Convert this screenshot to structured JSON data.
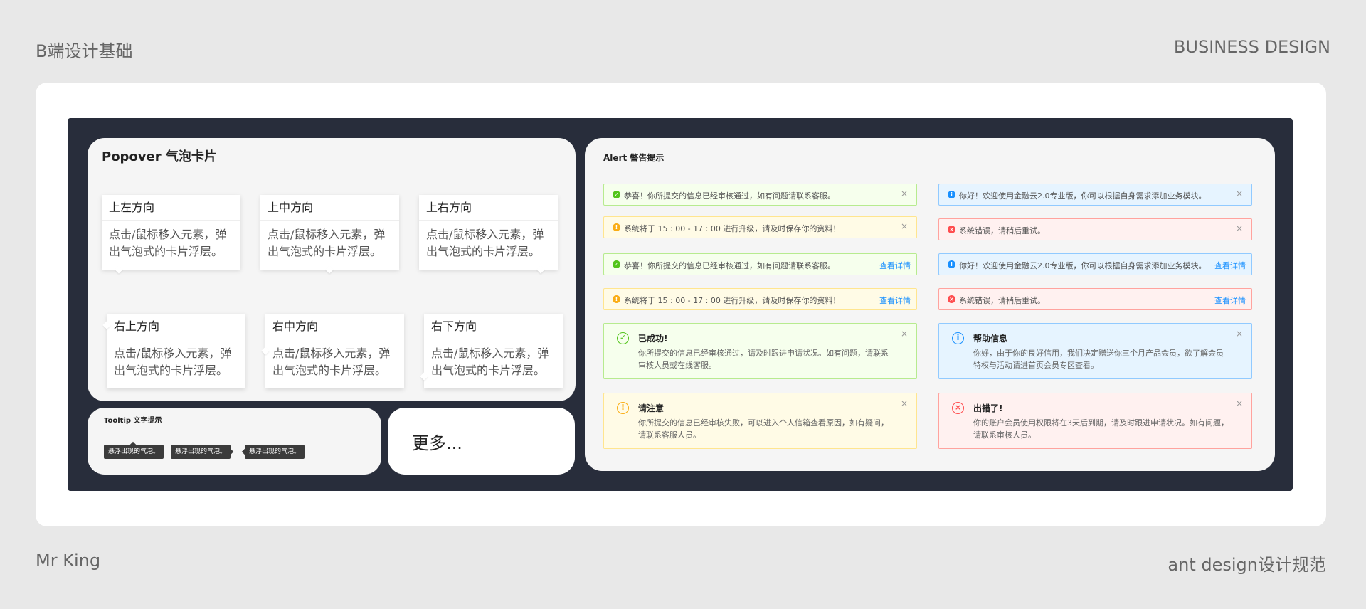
{
  "header": {
    "left": "B端设计基础",
    "right": "BUSINESS DESIGN"
  },
  "footer": {
    "left": "Mr King",
    "right": "ant design设计规范"
  },
  "popover": {
    "title": "Popover 气泡卡片",
    "cards": [
      {
        "title": "上左方向",
        "body": "点击/鼠标移入元素，弹出气泡式的卡片浮层。"
      },
      {
        "title": "上中方向",
        "body": "点击/鼠标移入元素，弹出气泡式的卡片浮层。"
      },
      {
        "title": "上右方向",
        "body": "点击/鼠标移入元素，弹出气泡式的卡片浮层。"
      },
      {
        "title": "右上方向",
        "body": "点击/鼠标移入元素，弹出气泡式的卡片浮层。"
      },
      {
        "title": "右中方向",
        "body": "点击/鼠标移入元素，弹出气泡式的卡片浮层。"
      },
      {
        "title": "右下方向",
        "body": "点击/鼠标移入元素，弹出气泡式的卡片浮层。"
      }
    ]
  },
  "tooltip": {
    "title": "Tooltip 文字提示",
    "tips": [
      "悬浮出现的气泡。",
      "悬浮出现的气泡。",
      "悬浮出现的气泡。"
    ]
  },
  "more": {
    "label": "更多..."
  },
  "alert": {
    "title": "Alert 警告提示",
    "close": "×",
    "detail_link": "查看详情",
    "items": [
      {
        "type": "success",
        "text": "恭喜！你所提交的信息已经审核通过，如有问题请联系客服。"
      },
      {
        "type": "info",
        "text": "你好！欢迎使用金融云2.0专业版，你可以根据自身需求添加业务模块。"
      },
      {
        "type": "warning",
        "text": "系统将于 15 : 00 - 17 : 00 进行升级，请及时保存你的资料！"
      },
      {
        "type": "error",
        "text": "系统错误，请稍后重试。"
      },
      {
        "type": "success",
        "text": "恭喜！你所提交的信息已经审核通过，如有问题请联系客服。"
      },
      {
        "type": "info",
        "text": "你好！欢迎使用金融云2.0专业版，你可以根据自身需求添加业务模块。"
      },
      {
        "type": "warning",
        "text": "系统将于 15 : 00 - 17 : 00 进行升级，请及时保存你的资料！"
      },
      {
        "type": "error",
        "text": "系统错误，请稍后重试。"
      }
    ],
    "big": [
      {
        "type": "success",
        "title": "已成功!",
        "desc": "你所提交的信息已经审核通过，请及时跟进申请状况。如有问题，请联系审核人员或在线客服。"
      },
      {
        "type": "info",
        "title": "帮助信息",
        "desc": "你好，由于你的良好信用，我们决定赠送你三个月产品会员，欲了解会员特权与活动请进首页会员专区查看。"
      },
      {
        "type": "warning",
        "title": "请注意",
        "desc": "你所提交的信息已经审核失败，可以进入个人信箱查看原因，如有疑问，请联系客服人员。"
      },
      {
        "type": "error",
        "title": "出错了!",
        "desc": "你的账户会员使用权限将在3天后到期，请及时跟进申请状况。如有问题，请联系审核人员。"
      }
    ]
  },
  "colors": {
    "success": "#52c41a",
    "info": "#1890ff",
    "warning": "#faad14",
    "error": "#ff4d4f",
    "dark_bg": "#282d3b"
  }
}
